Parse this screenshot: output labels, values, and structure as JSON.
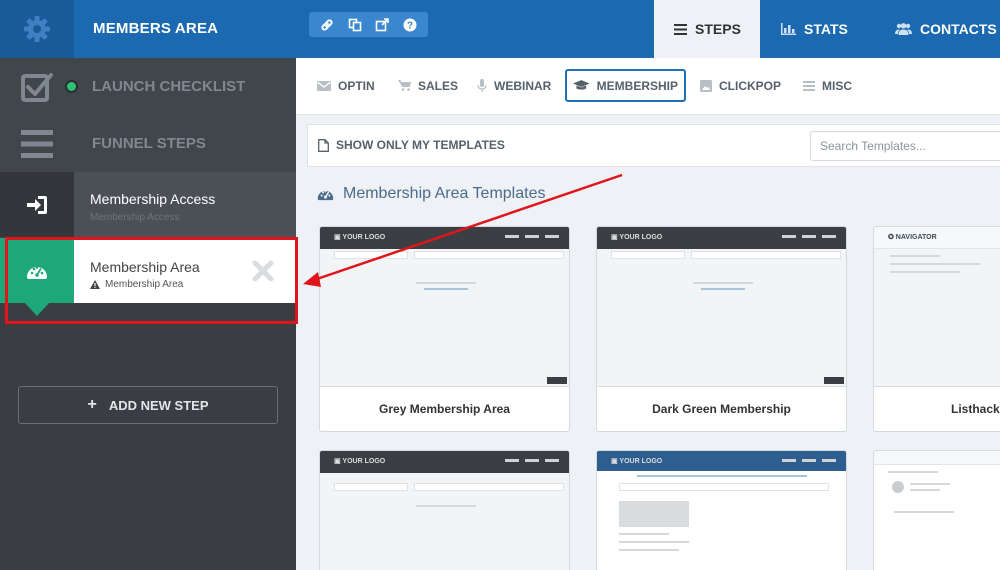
{
  "header": {
    "app_title": "MEMBERS AREA",
    "tools": [
      "link-icon",
      "copy-icon",
      "external-link-icon",
      "help-icon"
    ],
    "tabs": [
      {
        "label": "STEPS",
        "icon": "list-icon",
        "active": true
      },
      {
        "label": "STATS",
        "icon": "bar-chart-icon",
        "active": false
      },
      {
        "label": "CONTACTS",
        "icon": "users-icon",
        "active": false
      }
    ]
  },
  "sidebar": {
    "checklist_label": "LAUNCH CHECKLIST",
    "funnel_label": "FUNNEL STEPS",
    "steps": [
      {
        "name": "Membership Access",
        "sub": "Membership Access",
        "icon": "sign-in-icon"
      },
      {
        "name": "Membership Area",
        "sub": "Membership Area",
        "icon": "dashboard-icon",
        "warning_icon": "warning-icon"
      }
    ],
    "add_step_label": "ADD NEW STEP",
    "add_step_icon": "+"
  },
  "subnav": {
    "tabs": [
      {
        "label": "OPTIN",
        "icon": "envelope-icon"
      },
      {
        "label": "SALES",
        "icon": "cart-icon"
      },
      {
        "label": "WEBINAR",
        "icon": "microphone-icon"
      },
      {
        "label": "MEMBERSHIP",
        "icon": "graduation-cap-icon",
        "active": true
      },
      {
        "label": "CLICKPOP",
        "icon": "image-icon"
      },
      {
        "label": "MISC",
        "icon": "menu-icon"
      }
    ]
  },
  "filters": {
    "show_mine_label": "SHOW ONLY MY TEMPLATES",
    "search_placeholder": "Search Templates..."
  },
  "section_title": "Membership Area Templates",
  "templates": [
    {
      "name": "Grey Membership Area"
    },
    {
      "name": "Dark Green Membership"
    },
    {
      "name": "Listhacki"
    }
  ],
  "colors": {
    "brand_blue": "#1b6ab1",
    "sidebar_dark": "#3a3e43",
    "active_green": "#1ea87a",
    "highlight_red": "#e0151b",
    "status_green": "#2fc176"
  }
}
